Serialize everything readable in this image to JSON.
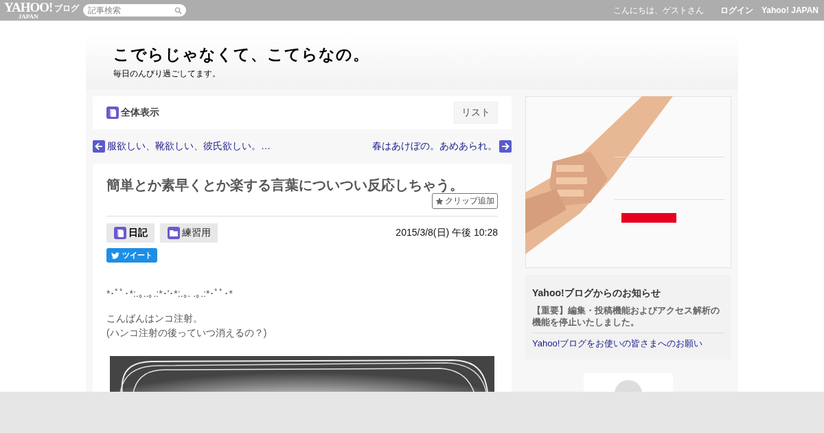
{
  "top_bar": {
    "logo": {
      "text": "YAHOO!",
      "sub": "JAPAN",
      "service": "ブログ"
    },
    "search": {
      "placeholder": "記事検索"
    },
    "greeting": "こんにちは、ゲストさん",
    "links": [
      "ログイン",
      "Yahoo! JAPAN"
    ]
  },
  "blog": {
    "title": "こでらじゃなくて、こてらなの。",
    "subtitle": "毎日のんびり過ごしてます。"
  },
  "view_bar": {
    "label": "全体表示",
    "list_button": "リスト"
  },
  "nav": {
    "prev": "服欲しい、靴欲しい、彼氏欲しい。…",
    "next": "春はあけぼの。あめあられ。"
  },
  "article": {
    "title": "簡単とか素早くとか楽する言葉についつい反応しちゃう。",
    "clip_button": "クリップ追加",
    "categories": [
      {
        "label": "日記",
        "kind": "book"
      },
      {
        "label": "練習用",
        "kind": "folder"
      }
    ],
    "date": "2015/3/8(日) 午後 10:28",
    "tweet_button": "ツイート",
    "paragraphs": [
      "*･ﾟﾟ･*:.｡..｡.:*･'･*:.｡. .｡.:*･ﾟﾟ･*",
      "こんばんはンコ注射。\n(ハンコ注射の後っていつ消えるの？)"
    ]
  },
  "sidebar": {
    "notice": {
      "title": "Yahoo!ブログからのお知らせ",
      "items": [
        {
          "text": "【重要】編集・投稿機能およびアクセス解析の機能を停止いたしました。",
          "kind": "important"
        },
        {
          "text": "Yahoo!ブログをお使いの皆さまへのお願い",
          "kind": "link"
        }
      ]
    }
  }
}
